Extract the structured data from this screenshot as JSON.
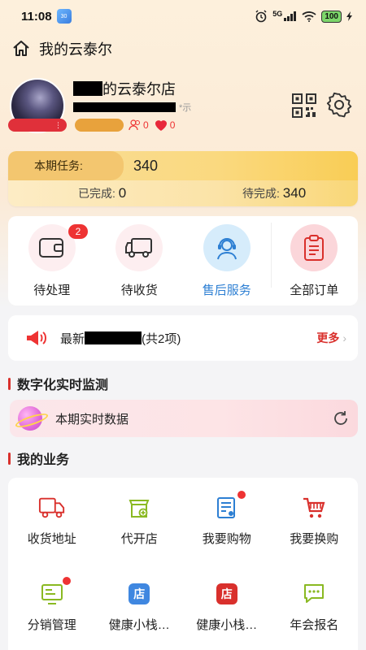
{
  "status_bar": {
    "time": "11:08",
    "app_badge": "30",
    "signal": "5G",
    "battery": "100"
  },
  "header": {
    "title": "我的云泰尔"
  },
  "profile": {
    "shop_name_suffix": "的云泰尔店",
    "sub_suffix": "*示",
    "follow_count": "0",
    "like_count": "0"
  },
  "task": {
    "period_label": "本期任务:",
    "period_value": "340",
    "done_label": "已完成:",
    "done_value": "0",
    "pending_label": "待完成:",
    "pending_value": "340"
  },
  "orders": [
    {
      "label": "待处理",
      "badge": "2"
    },
    {
      "label": "待收货"
    },
    {
      "label": "售后服务"
    },
    {
      "label": "全部订单"
    }
  ],
  "notice": {
    "prefix": "最新",
    "suffix": "(共2项)",
    "more": "更多"
  },
  "monitor": {
    "title": "数字化实时监测",
    "item": "本期实时数据"
  },
  "business": {
    "title": "我的业务",
    "items": [
      {
        "label": "收货地址",
        "icon": "truck-icon"
      },
      {
        "label": "代开店",
        "icon": "shop-add-icon"
      },
      {
        "label": "我要购物",
        "icon": "order-list-icon"
      },
      {
        "label": "我要换购",
        "icon": "cart-icon"
      },
      {
        "label": "分销管理",
        "icon": "distribution-icon"
      },
      {
        "label": "健康小栈…",
        "icon": "store-blue-icon",
        "glyph": "店"
      },
      {
        "label": "健康小栈…",
        "icon": "store-red-icon",
        "glyph": "店"
      },
      {
        "label": "年会报名",
        "icon": "chat-icon"
      }
    ]
  },
  "colors": {
    "accent_red": "#d9302c",
    "active_blue": "#2d7fd3",
    "task_gold": "#f3c66f"
  }
}
